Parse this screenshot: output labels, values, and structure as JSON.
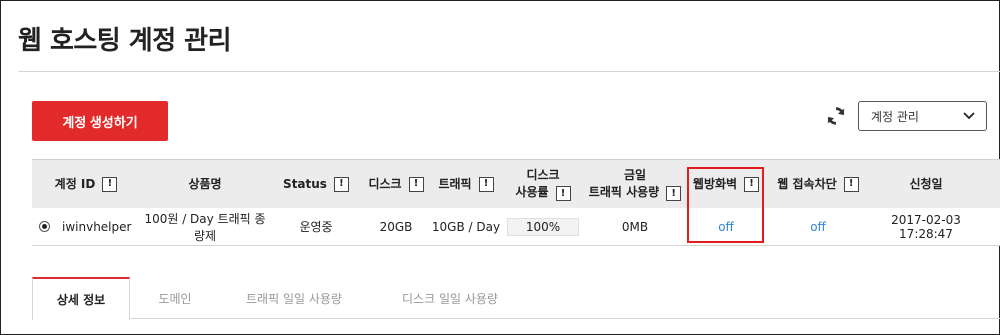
{
  "page": {
    "title": "웹 호스팅 계정 관리"
  },
  "toolbar": {
    "create_label": "계정 생성하기",
    "refresh_icon": "refresh-icon",
    "select": {
      "value": "계정 관리",
      "icon": "chevron-down-icon"
    }
  },
  "table": {
    "headers": [
      {
        "label": "계정 ID",
        "info": "!"
      },
      {
        "label": "상품명"
      },
      {
        "label": "Status",
        "info": "!"
      },
      {
        "label": "디스크",
        "info": "!"
      },
      {
        "label": "트래픽",
        "info": "!"
      },
      {
        "label_line1": "디스크",
        "label_line2": "사용률",
        "info": "!"
      },
      {
        "label_line1": "금일",
        "label_line2": "트래픽 사용량",
        "info": "!"
      },
      {
        "label": "웹방화벽",
        "info": "!"
      },
      {
        "label": "웹 접속차단",
        "info": "!"
      },
      {
        "label": "신청일"
      }
    ],
    "rows": [
      {
        "selected": true,
        "account_id": "iwinvhelper",
        "product": "100원 / Day 트래픽 종량제",
        "status": "운영중",
        "disk": "20GB",
        "traffic": "10GB / Day",
        "disk_usage": "100%",
        "disk_usage_fraction": 1.0,
        "today_traffic": "0MB",
        "web_firewall": "off",
        "web_block": "off",
        "applied_at": "2017-02-03 17:28:47"
      }
    ]
  },
  "tabs": [
    {
      "label": "상세 정보",
      "active": true
    },
    {
      "label": "도메인",
      "active": false
    },
    {
      "label": "트래픽 일일 사용량",
      "active": false
    },
    {
      "label": "디스크 일일 사용량",
      "active": false
    }
  ],
  "colors": {
    "accent": "#e22a2a",
    "link": "#2f86d6",
    "highlight": "#e31c1c"
  }
}
